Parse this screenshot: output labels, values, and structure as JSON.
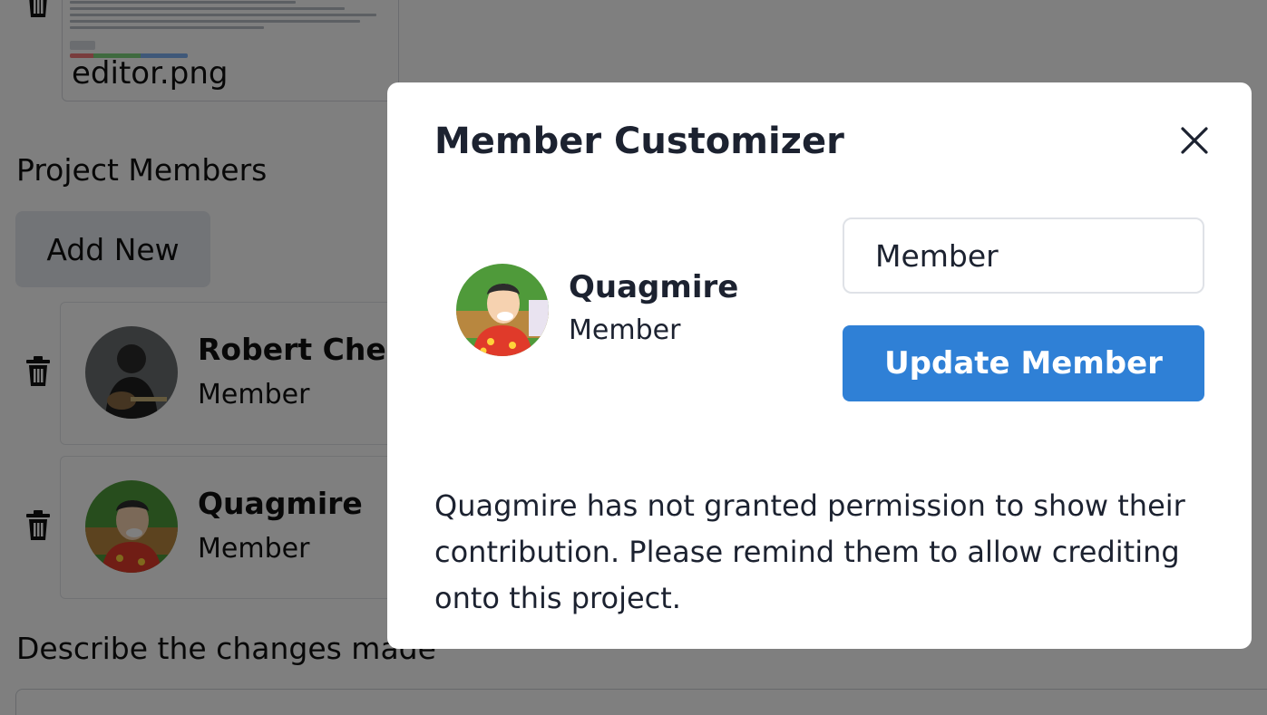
{
  "background": {
    "attachment": {
      "filename": "editor.png"
    },
    "members_section": {
      "title": "Project Members",
      "add_button_label": "Add New",
      "members": [
        {
          "name": "Robert Chen",
          "role": "Member",
          "avatar_icon": "person-guitar-avatar"
        },
        {
          "name": "Quagmire",
          "role": "Member",
          "avatar_icon": "cartoon-character-avatar"
        }
      ]
    },
    "changes_section": {
      "title": "Describe the changes made"
    }
  },
  "modal": {
    "title": "Member Customizer",
    "close_icon": "close-icon",
    "member": {
      "name": "Quagmire",
      "role": "Member",
      "avatar_icon": "cartoon-character-avatar"
    },
    "role_input_value": "Member",
    "update_button_label": "Update Member",
    "notice": "Quagmire has not granted permission to show their contribution. Please remind them to allow crediting onto this project."
  },
  "colors": {
    "accent": "#2f80d6",
    "overlay": "rgba(0,0,0,0.5)",
    "text": "#1c2230"
  }
}
